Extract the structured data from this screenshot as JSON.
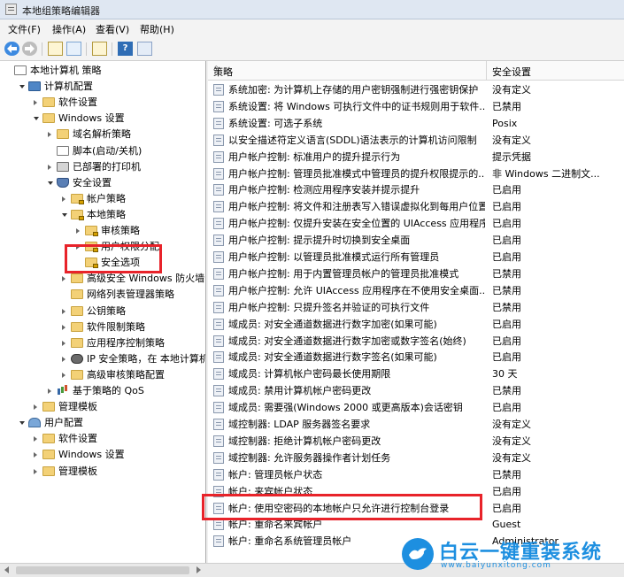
{
  "window": {
    "title": "本地组策略编辑器"
  },
  "menu": [
    "文件(F)",
    "操作(A)",
    "查看(V)",
    "帮助(H)"
  ],
  "toolbar": [
    "back-icon",
    "forward-icon",
    "up-folder-icon",
    "show-hide-tree-icon",
    "export-list-icon",
    "help-icon",
    "properties-icon"
  ],
  "tree": [
    {
      "label": "本地计算机 策略",
      "level": 0,
      "expander": "none",
      "icon": "doc"
    },
    {
      "label": "计算机配置",
      "level": 1,
      "expander": "open",
      "icon": "pc"
    },
    {
      "label": "软件设置",
      "level": 2,
      "expander": "closed",
      "icon": "folder"
    },
    {
      "label": "Windows 设置",
      "level": 2,
      "expander": "open",
      "icon": "folder"
    },
    {
      "label": "域名解析策略",
      "level": 3,
      "expander": "closed",
      "icon": "folder"
    },
    {
      "label": "脚本(启动/关机)",
      "level": 3,
      "expander": "none",
      "icon": "doc"
    },
    {
      "label": "已部署的打印机",
      "level": 3,
      "expander": "closed",
      "icon": "printer"
    },
    {
      "label": "安全设置",
      "level": 3,
      "expander": "open",
      "icon": "shield"
    },
    {
      "label": "帐户策略",
      "level": 4,
      "expander": "closed",
      "icon": "lock"
    },
    {
      "label": "本地策略",
      "level": 4,
      "expander": "open",
      "icon": "lock"
    },
    {
      "label": "审核策略",
      "level": 5,
      "expander": "closed",
      "icon": "lock"
    },
    {
      "label": "用户权限分配",
      "level": 5,
      "expander": "closed",
      "icon": "lock"
    },
    {
      "label": "安全选项",
      "level": 5,
      "expander": "none",
      "icon": "lock"
    },
    {
      "label": "高级安全 Windows 防火墙",
      "level": 4,
      "expander": "closed",
      "icon": "folder"
    },
    {
      "label": "网络列表管理器策略",
      "level": 4,
      "expander": "none",
      "icon": "folder"
    },
    {
      "label": "公钥策略",
      "level": 4,
      "expander": "closed",
      "icon": "folder"
    },
    {
      "label": "软件限制策略",
      "level": 4,
      "expander": "closed",
      "icon": "folder"
    },
    {
      "label": "应用程序控制策略",
      "level": 4,
      "expander": "closed",
      "icon": "folder"
    },
    {
      "label": "IP 安全策略，在 本地计算机",
      "level": 4,
      "expander": "closed",
      "icon": "ipsec"
    },
    {
      "label": "高级审核策略配置",
      "level": 4,
      "expander": "closed",
      "icon": "folder"
    },
    {
      "label": "基于策略的 QoS",
      "level": 3,
      "expander": "closed",
      "icon": "chart"
    },
    {
      "label": "管理模板",
      "level": 2,
      "expander": "closed",
      "icon": "folder"
    },
    {
      "label": "用户配置",
      "level": 1,
      "expander": "open",
      "icon": "user"
    },
    {
      "label": "软件设置",
      "level": 2,
      "expander": "closed",
      "icon": "folder"
    },
    {
      "label": "Windows 设置",
      "level": 2,
      "expander": "closed",
      "icon": "folder"
    },
    {
      "label": "管理模板",
      "level": 2,
      "expander": "closed",
      "icon": "folder"
    }
  ],
  "list": {
    "col_policy": "策略",
    "col_setting": "安全设置",
    "rows": [
      {
        "name": "系统加密: 为计算机上存储的用户密钥强制进行强密钥保护",
        "value": "没有定义"
      },
      {
        "name": "系统设置: 将 Windows 可执行文件中的证书规则用于软件...",
        "value": "已禁用"
      },
      {
        "name": "系统设置: 可选子系统",
        "value": "Posix"
      },
      {
        "name": "以安全描述符定义语言(SDDL)语法表示的计算机访问限制",
        "value": "没有定义"
      },
      {
        "name": "用户帐户控制: 标准用户的提升提示行为",
        "value": "提示凭据"
      },
      {
        "name": "用户帐户控制: 管理员批准模式中管理员的提升权限提示的...",
        "value": "非 Windows 二进制文..."
      },
      {
        "name": "用户帐户控制: 检测应用程序安装并提示提升",
        "value": "已启用"
      },
      {
        "name": "用户帐户控制: 将文件和注册表写入错误虚拟化到每用户位置",
        "value": "已启用"
      },
      {
        "name": "用户帐户控制: 仅提升安装在安全位置的 UIAccess 应用程序",
        "value": "已启用"
      },
      {
        "name": "用户帐户控制: 提示提升时切换到安全桌面",
        "value": "已启用"
      },
      {
        "name": "用户帐户控制: 以管理员批准模式运行所有管理员",
        "value": "已启用"
      },
      {
        "name": "用户帐户控制: 用于内置管理员帐户的管理员批准模式",
        "value": "已禁用"
      },
      {
        "name": "用户帐户控制: 允许 UIAccess 应用程序在不使用安全桌面...",
        "value": "已禁用"
      },
      {
        "name": "用户帐户控制: 只提升签名并验证的可执行文件",
        "value": "已禁用"
      },
      {
        "name": "域成员: 对安全通道数据进行数字加密(如果可能)",
        "value": "已启用"
      },
      {
        "name": "域成员: 对安全通道数据进行数字加密或数字签名(始终)",
        "value": "已启用"
      },
      {
        "name": "域成员: 对安全通道数据进行数字签名(如果可能)",
        "value": "已启用"
      },
      {
        "name": "域成员: 计算机帐户密码最长使用期限",
        "value": "30 天"
      },
      {
        "name": "域成员: 禁用计算机帐户密码更改",
        "value": "已禁用"
      },
      {
        "name": "域成员: 需要强(Windows 2000 或更高版本)会话密钥",
        "value": "已启用"
      },
      {
        "name": "域控制器: LDAP 服务器签名要求",
        "value": "没有定义"
      },
      {
        "name": "域控制器: 拒绝计算机帐户密码更改",
        "value": "没有定义"
      },
      {
        "name": "域控制器: 允许服务器操作者计划任务",
        "value": "没有定义"
      },
      {
        "name": "帐户: 管理员帐户状态",
        "value": "已禁用"
      },
      {
        "name": "帐户: 来宾帐户状态",
        "value": "已启用"
      },
      {
        "name": "帐户: 使用空密码的本地帐户只允许进行控制台登录",
        "value": "已启用"
      },
      {
        "name": "帐户: 重命名来宾帐户",
        "value": "Guest"
      },
      {
        "name": "帐户: 重命名系统管理员帐户",
        "value": "Administrator"
      }
    ]
  },
  "watermark": {
    "text": "白云一键重装系统",
    "url": "www.baiyunxitong.com"
  },
  "colors": {
    "highlight": "#e8232a",
    "watermark": "#1d8fe0"
  }
}
